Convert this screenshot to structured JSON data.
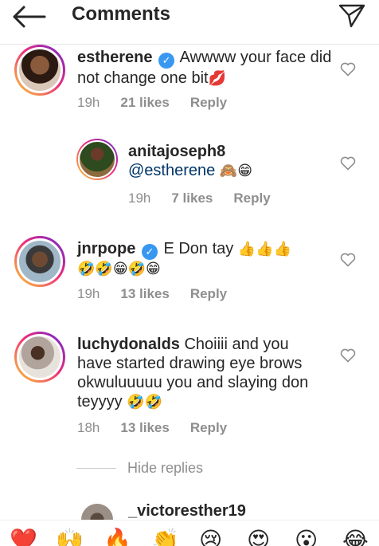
{
  "header": {
    "title": "Comments",
    "back_icon": "arrow-left-icon",
    "share_icon": "paper-plane-icon"
  },
  "colors": {
    "verified": "#3897f0",
    "meta_text": "#8e8e8e",
    "primary_text": "#262626",
    "heart_outline": "#8e8e8e"
  },
  "comments": [
    {
      "username": "estherene",
      "verified": true,
      "text": "Awwww your face did not change one bit",
      "emoji": "💋",
      "time": "19h",
      "likes": "21 likes",
      "reply": "Reply"
    },
    {
      "username": "anitajoseph8",
      "verified": false,
      "mention": "@estherene",
      "emoji": "🙈😁",
      "time": "19h",
      "likes": "7 likes",
      "reply": "Reply"
    },
    {
      "username": "jnrpope",
      "verified": true,
      "text": "E Don tay",
      "emoji_inline": "👍👍👍",
      "emoji_line2": "🤣🤣😁🤣😁",
      "time": "19h",
      "likes": "13 likes",
      "reply": "Reply"
    },
    {
      "username": "luchydonalds",
      "verified": false,
      "text_line1": "Choiiii and you",
      "text_line2": "have started drawing eye brows",
      "text_line3": "okwuluuuuu you and slaying don",
      "text_line4": "teyyyy",
      "emoji": "🤣🤣",
      "time": "18h",
      "likes": "13 likes",
      "reply": "Reply"
    },
    {
      "username": "_victoresther19"
    }
  ],
  "hide_replies": "Hide replies",
  "emoji_bar": [
    "❤️",
    "🙌",
    "🔥",
    "👏",
    "😢",
    "😍",
    "😮",
    "😂"
  ]
}
